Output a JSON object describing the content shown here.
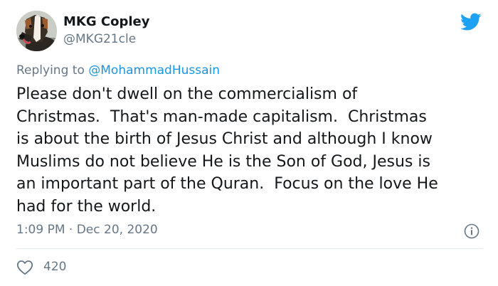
{
  "author": {
    "display_name": "MKG Copley",
    "handle": "@MKG21cle",
    "avatar_icon": "dog-avatar"
  },
  "reply": {
    "prefix": "Replying to",
    "mention": "@MohammadHussain"
  },
  "tweet": {
    "lines": [
      "Please don't dwell on the commercialism of",
      "Christmas.  That's man-made capitalism.  Christmas",
      "is about the birth of Jesus Christ and although I know",
      "Muslims do not believe He is the Son of God, Jesus is",
      "an important part of the Quran.  Focus on the love He",
      "had for the world."
    ],
    "time": "1:09 PM",
    "separator": "·",
    "date": "Dec 20, 2020"
  },
  "engagement": {
    "likes": "420"
  },
  "colors": {
    "brand": "#1da1f2",
    "mention": "#1b95e0",
    "secondary_text": "#657786",
    "divider": "#e1e8ed"
  },
  "icons": {
    "brand_logo": "twitter-bird-icon",
    "info": "info-icon",
    "like": "heart-outline-icon"
  }
}
